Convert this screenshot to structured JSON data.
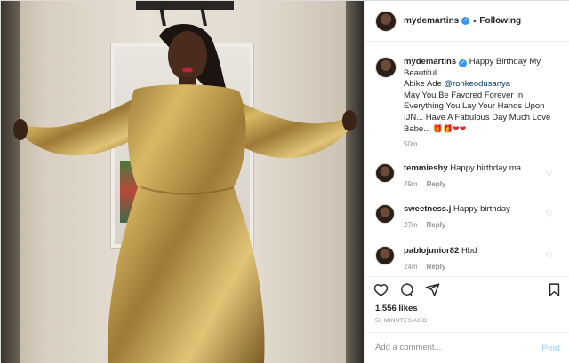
{
  "post": {
    "username": "mydemartins",
    "follow_status": "Following",
    "separator": "•"
  },
  "caption": {
    "username": "mydemartins",
    "line1": "Happy Birthday My Beautiful",
    "line2_prefix": "Abike Ade ",
    "mention": "@ronkeodusanya",
    "line3": "May You Be Favored Forever In Everything You Lay Your Hands Upon IJN... Have A Fabulous Day Much Love Babe...",
    "emoji_gifts": "🎁🎁",
    "emoji_hearts": "❤❤",
    "time": "50m"
  },
  "comments": [
    {
      "username": "temmieshy",
      "text": "Happy birthday ma",
      "time": "49m",
      "reply": "Reply"
    },
    {
      "username": "sweetness.j",
      "text": "Happy birthday",
      "time": "27m",
      "reply": "Reply"
    },
    {
      "username": "pablojunior82",
      "text": "Hbd",
      "time": "24m",
      "reply": "Reply"
    }
  ],
  "actions": {
    "likes": "1,556 likes",
    "posted_ago": "50 MINUTES AGO",
    "comment_placeholder": "Add a comment...",
    "post_label": "Post"
  },
  "icons": {
    "like": "heart-icon",
    "comment": "comment-icon",
    "share": "share-icon",
    "save": "bookmark-icon",
    "verified": "verified-badge-icon",
    "comment_like": "small-heart-icon"
  },
  "colors": {
    "verified_blue": "#3897f0",
    "mention_blue": "#00376b",
    "post_button_disabled": "#b2dffc",
    "meta_gray": "#8e8e8e"
  }
}
